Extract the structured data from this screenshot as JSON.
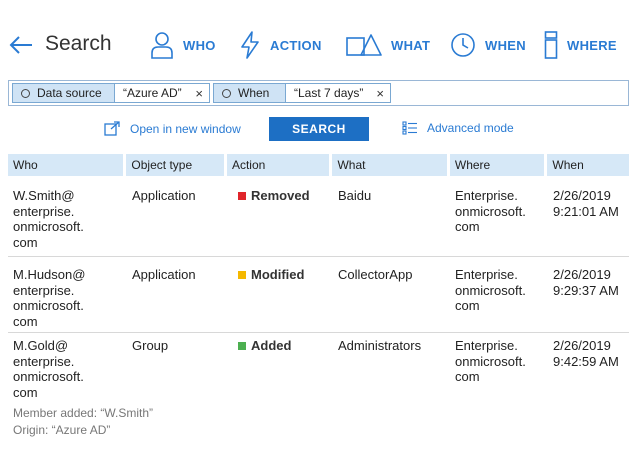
{
  "header": {
    "title": "Search",
    "nav": [
      {
        "label": "WHO",
        "icon": "person-icon"
      },
      {
        "label": "ACTION",
        "icon": "lightning-icon"
      },
      {
        "label": "WHAT",
        "icon": "shapes-icon"
      },
      {
        "label": "WHEN",
        "icon": "clock-icon"
      },
      {
        "label": "WHERE",
        "icon": "server-icon"
      }
    ]
  },
  "search": {
    "filters": [
      {
        "key": "Data source",
        "value": "“Azure AD”"
      },
      {
        "key": "When",
        "value": "“Last 7 days”"
      }
    ],
    "remove_glyph": "×"
  },
  "actions": {
    "open_new_window": "Open in new window",
    "search_button": "SEARCH",
    "advanced_mode": "Advanced mode"
  },
  "table": {
    "columns": [
      "Who",
      "Object type",
      "Action",
      "What",
      "Where",
      "When"
    ],
    "rows": [
      {
        "who": "W.Smith@\nenterprise.\nonmicrosoft.\ncom",
        "object_type": "Application",
        "action": "Removed",
        "action_color": "#e0252b",
        "what": "Baidu",
        "where": "Enterprise.\nonmicrosoft.\ncom",
        "when": "2/26/2019\n9:21:01 AM"
      },
      {
        "who": "M.Hudson@\nenterprise.\nonmicrosoft.\ncom",
        "object_type": "Application",
        "action": "Modified",
        "action_color": "#f5b800",
        "what": "CollectorApp",
        "where": "Enterprise.\nonmicrosoft.\ncom",
        "when": "2/26/2019\n9:29:37 AM"
      },
      {
        "who": "M.Gold@\nenterprise.\nonmicrosoft.\ncom",
        "object_type": "Group",
        "action": "Added",
        "action_color": "#4caf50",
        "what": "Administrators",
        "where": "Enterprise.\nonmicrosoft.\ncom",
        "when": "2/26/2019\n9:42:59 AM",
        "details": [
          "Member added: “W.Smith”",
          "Origin: “Azure AD”"
        ]
      }
    ]
  },
  "colors": {
    "accent": "#2a7bd3",
    "button": "#1d6fc4",
    "header_bg": "#d6e8f7",
    "chip_bg": "#cfe3f5"
  }
}
